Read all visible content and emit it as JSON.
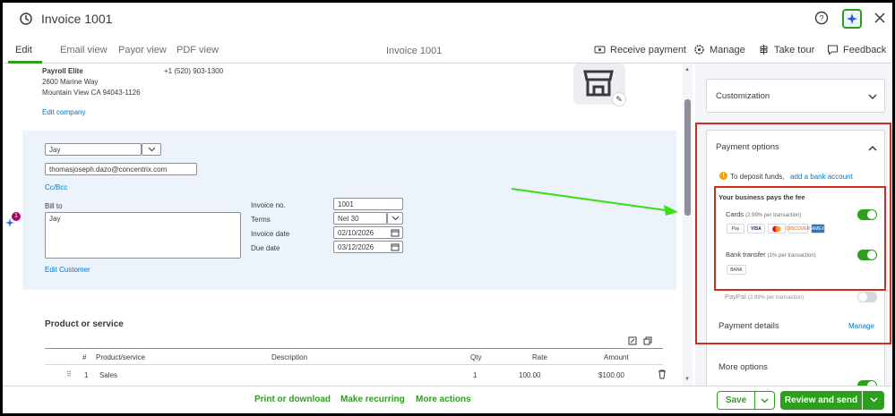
{
  "title": "Invoice 1001",
  "tabs": [
    "Edit",
    "Email view",
    "Payor view",
    "PDF view"
  ],
  "center_title": "Invoice 1001",
  "header_actions": [
    "Receive payment",
    "Manage",
    "Take tour",
    "Feedback"
  ],
  "company": {
    "name": "Payroll Elite",
    "phone": "+1 (520) 903-1300",
    "address1": "2600 Marine Way",
    "address2": "Mountain View CA 94043-1126",
    "edit_link": "Edit company"
  },
  "customer": {
    "name": "Jay",
    "email": "thomasjoseph.dazo@concentrix.com",
    "cc_link": "Cc/Bcc",
    "bill_to_label": "Bill to",
    "bill_to_value": "Jay",
    "edit_link": "Edit Customer"
  },
  "invoice_fields": {
    "invoice_no_label": "Invoice no.",
    "invoice_no": "1001",
    "terms_label": "Terms",
    "terms": "Net 30",
    "invoice_date_label": "Invoice date",
    "invoice_date": "02/10/2026",
    "due_date_label": "Due date",
    "due_date": "03/12/2026"
  },
  "products": {
    "heading": "Product or service",
    "columns": [
      "#",
      "Product/service",
      "Description",
      "Qty",
      "Rate",
      "Amount"
    ],
    "rows": [
      {
        "num": "1",
        "product": "Sales",
        "description": "",
        "qty": "1",
        "rate": "100.00",
        "amount": "$100.00"
      }
    ]
  },
  "right_panel": {
    "customization": "Customization",
    "payment_options": "Payment options",
    "deposit_text": "To deposit funds,",
    "deposit_link": "add a bank account",
    "fee_title": "Your business pays the fee",
    "cards_label": "Cards",
    "cards_fee": "(2.99% per transaction)",
    "card_logos": [
      "Pay",
      "VISA",
      "MC",
      "DISCOVER",
      "AMEX"
    ],
    "bank_label": "Bank transfer",
    "bank_fee": "(1% per transaction)",
    "bank_logo": "BANK",
    "paypal_label": "PayPal",
    "paypal_fee": "(2.99% per transaction)",
    "payment_details": "Payment details",
    "manage": "Manage",
    "more_options": "More options"
  },
  "bottom": {
    "print": "Print or download",
    "recurring": "Make recurring",
    "more": "More actions",
    "save": "Save",
    "review": "Review and send"
  },
  "colors": {
    "accent": "#2ca01c",
    "link": "#0077c5",
    "highlight": "#d52b1e",
    "arrow": "#39e015"
  }
}
